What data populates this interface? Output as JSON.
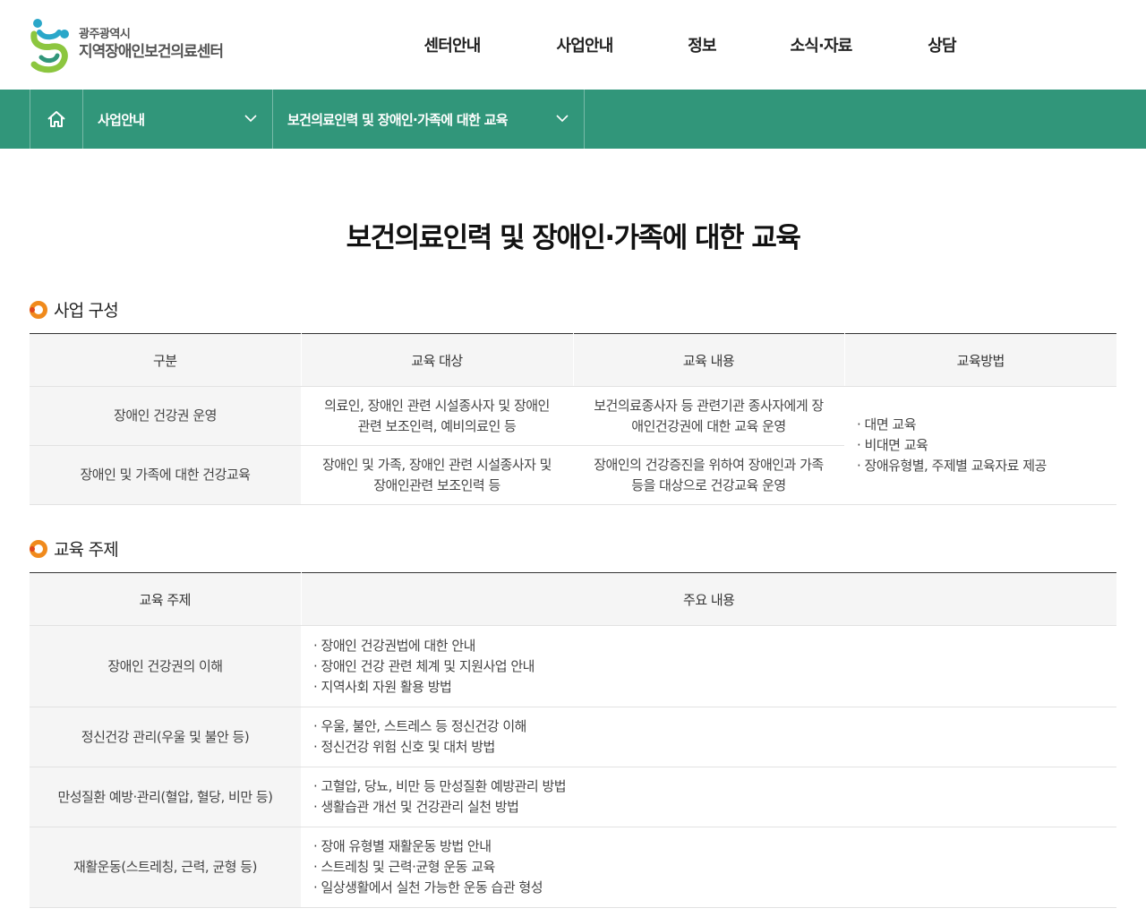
{
  "header": {
    "logo_sub": "광주광역시",
    "logo_main": "지역장애인보건의료센터",
    "nav": [
      "센터안내",
      "사업안내",
      "정보",
      "소식·자료",
      "상담"
    ]
  },
  "location": {
    "home_icon": "home-icon",
    "level1": "사업안내",
    "level2": "보건의료인력 및 장애인·가족에 대한 교육"
  },
  "page_title": "보건의료인력 및 장애인·가족에 대한 교육",
  "section1": {
    "title": "사업 구성",
    "headers": [
      "구분",
      "교육 대상",
      "교육 내용",
      "교육방법"
    ],
    "rows": [
      {
        "category": "장애인 건강권 운영",
        "target": [
          "의료인, 장애인 관련 시설종사자 및 장애인",
          "관련 보조인력, 예비의료인 등"
        ],
        "content": [
          "보건의료종사자 등 관련기관 종사자에게 장",
          "애인건강권에 대한 교육 운영"
        ]
      },
      {
        "category": "장애인 및 가족에 대한 건강교육",
        "target": [
          "장애인 및 가족, 장애인 관련 시설종사자 및",
          "장애인관련 보조인력 등"
        ],
        "content": [
          "장애인의 건강증진을 위하여 장애인과 가족",
          "등을 대상으로 건강교육 운영"
        ]
      }
    ],
    "methods": [
      "대면 교육",
      "비대면 교육",
      "장애유형별, 주제별 교육자료 제공"
    ]
  },
  "section2": {
    "title": "교육 주제",
    "headers": [
      "교육 주제",
      "주요 내용"
    ],
    "rows": [
      {
        "topic": "장애인 건강권의 이해",
        "items": [
          "장애인 건강권법에 대한 안내",
          "장애인 건강 관련 체계 및 지원사업 안내",
          "지역사회 자원 활용 방법"
        ]
      },
      {
        "topic": "정신건강 관리(우울 및 불안 등)",
        "items": [
          "우울, 불안, 스트레스 등 정신건강 이해",
          "정신건강 위험 신호 및 대처 방법"
        ]
      },
      {
        "topic": "만성질환 예방·관리(혈압, 혈당, 비만 등)",
        "items": [
          "고혈압, 당뇨, 비만 등 만성질환 예방관리 방법",
          "생활습관 개선 및 건강관리 실천 방법"
        ]
      },
      {
        "topic": "재활운동(스트레칭, 근력, 균형 등)",
        "items": [
          "장애 유형별 재활운동 방법 안내",
          "스트레칭 및 근력·균형 운동 교육",
          "일상생활에서 실천 가능한 운동 습관 형성"
        ]
      }
    ]
  },
  "colors": {
    "primary_green": "#31967a",
    "bullet_orange": "#f08a1c",
    "bullet_red": "#e2481d"
  }
}
